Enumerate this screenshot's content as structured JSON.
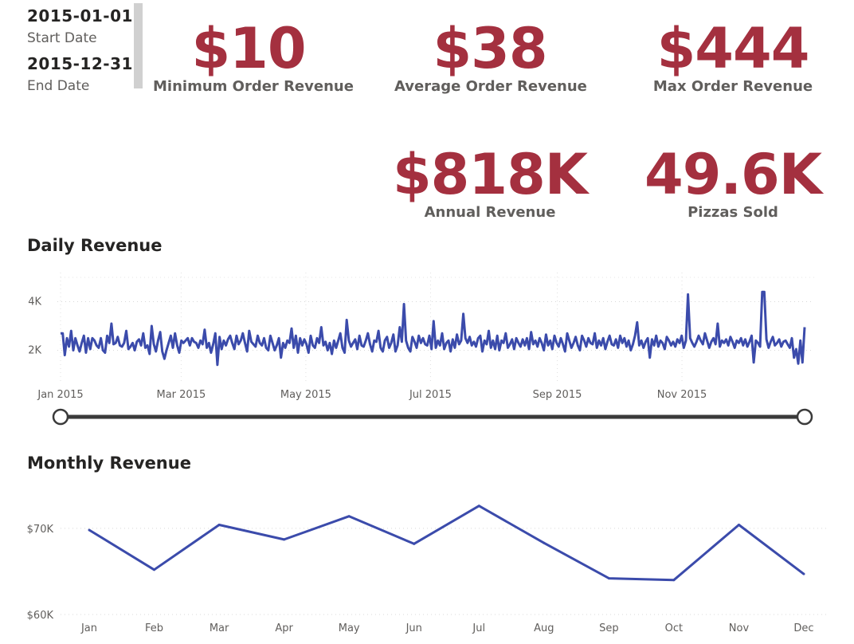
{
  "filters": {
    "start_date": "2015-01-01",
    "start_label": "Start Date",
    "end_date": "2015-12-31",
    "end_label": "End Date"
  },
  "kpis": {
    "min_order": {
      "value": "$10",
      "label": "Minimum Order Revenue"
    },
    "avg_order": {
      "value": "$38",
      "label": "Average Order Revenue"
    },
    "max_order": {
      "value": "$444",
      "label": "Max Order Revenue"
    },
    "annual": {
      "value": "$818K",
      "label": "Annual Revenue"
    },
    "pizzas": {
      "value": "49.6K",
      "label": "Pizzas Sold"
    }
  },
  "colors": {
    "kpi": "#a4303f",
    "line": "#3b4bab",
    "slider": "#3a3a3a"
  },
  "chart_data": [
    {
      "type": "line",
      "title": "Daily Revenue",
      "x_ticks": [
        "Jan 2015",
        "Mar 2015",
        "May 2015",
        "Jul 2015",
        "Sep 2015",
        "Nov 2015"
      ],
      "y_ticks": [
        "2K",
        "4K"
      ],
      "x_range": [
        "2015-01-01",
        "2015-12-31"
      ],
      "ylim": [
        1000,
        5000
      ],
      "grid": true,
      "range_slider": {
        "start": "2015-01-01",
        "end": "2015-12-31"
      },
      "series": [
        {
          "values": [
            2700,
            2700,
            1800,
            2500,
            2150,
            2800,
            2000,
            2500,
            2200,
            1950,
            2300,
            2600,
            1900,
            2500,
            2050,
            2500,
            2400,
            2200,
            2100,
            2500,
            2000,
            1900,
            2600,
            2300,
            3100,
            2250,
            2300,
            2550,
            2200,
            2150,
            2300,
            2800,
            2050,
            2150,
            2300,
            2000,
            2350,
            2450,
            2200,
            2700,
            2100,
            2200,
            1850,
            3000,
            2250,
            1950,
            2400,
            2750,
            1950,
            1650,
            2000,
            2300,
            2600,
            2100,
            2700,
            2200,
            1900,
            2400,
            2300,
            2400,
            2500,
            2200,
            2500,
            2350,
            2300,
            2100,
            2400,
            2250,
            2850,
            2100,
            2300,
            1900,
            2250,
            2700,
            1400,
            2550,
            2050,
            2400,
            2200,
            2450,
            2600,
            2300,
            2050,
            2600,
            2250,
            2400,
            2700,
            2300,
            1950,
            2800,
            2350,
            2250,
            2150,
            2600,
            2300,
            2200,
            2500,
            2100,
            2000,
            2600,
            2300,
            2000,
            2200,
            2500,
            1700,
            2300,
            2100,
            2400,
            2300,
            2900,
            2100,
            2600,
            1900,
            2500,
            2200,
            2450,
            2250,
            1900,
            2600,
            2200,
            2100,
            2500,
            2300,
            2950,
            2200,
            2350,
            2000,
            2300,
            1850,
            2400,
            2100,
            2400,
            2700,
            2100,
            1900,
            3250,
            2400,
            2150,
            2300,
            2450,
            2050,
            2600,
            2200,
            2150,
            2400,
            2700,
            2250,
            1950,
            2400,
            2350,
            2800,
            2100,
            1950,
            2400,
            2550,
            2100,
            2300,
            2650,
            1950,
            2200,
            2950,
            2350,
            2000,
            2400,
            2100,
            1950,
            2550,
            2350,
            2100,
            2600,
            2300,
            2500,
            2250,
            2200,
            2600,
            2050,
            2300,
            2100,
            2400,
            2200,
            2700,
            2050,
            2300,
            2400,
            1950,
            2450,
            2100,
            2650,
            2250,
            2400,
            2050,
            2500,
            2300,
            2550,
            2200,
            2350,
            2150,
            2500,
            2600,
            1950,
            2400,
            2250,
            2800,
            2100,
            2400,
            2050,
            2600,
            2000,
            2400,
            2300,
            2700,
            2100,
            2250,
            2450,
            2050,
            2500,
            2300,
            2150,
            2450,
            2200,
            2500,
            2050,
            2750,
            2250,
            2400,
            2150,
            2500,
            2300,
            2000,
            2650,
            2200,
            2400,
            2050,
            2600,
            2300,
            2150,
            2500,
            2250,
            1950,
            2700,
            2400,
            2100,
            2300,
            2550,
            2200,
            2000,
            2600,
            2400,
            2150,
            2500,
            2300,
            2250,
            2700,
            2100,
            2400,
            2200,
            2500,
            2050,
            2350,
            2600,
            2250,
            2200,
            2450,
            2100,
            2600,
            2300,
            2500,
            2150,
            2400,
            2000,
            2250,
            2600,
            2700,
            2200,
            2400,
            2100,
            2350,
            2500,
            2250,
            2450,
            2200,
            2600,
            2150,
            2400,
            2300,
            2050,
            2550,
            2400,
            2200,
            2350,
            2150,
            2450,
            2300,
            2600,
            2100,
            2400,
            2200,
            2500,
            2300,
            2150,
            2350,
            2600,
            2400,
            2250,
            2700,
            2400,
            2100,
            2350,
            2500,
            2250,
            2600,
            2150,
            2400,
            2300,
            2450,
            2200,
            2550,
            2350,
            2100,
            2400,
            2300,
            2500,
            2200,
            2450,
            2150,
            2350,
            2600,
            2200,
            2400,
            2300,
            2150,
            2500,
            2250,
            2450,
            2100,
            2350,
            2550,
            2200,
            2300,
            2450,
            2150,
            2350,
            2400,
            2250,
            2100,
            2500,
            1700,
            2050,
            1450,
            2400,
            1500,
            2950
          ],
          "spikes": [
            {
              "day": 162,
              "value": 3900
            },
            {
              "day": 176,
              "value": 3200
            },
            {
              "day": 190,
              "value": 3500
            },
            {
              "day": 296,
              "value": 4300
            },
            {
              "day": 331,
              "value": 4400
            },
            {
              "day": 332,
              "value": 4400
            },
            {
              "day": 327,
              "value": 1500
            },
            {
              "day": 272,
              "value": 3150
            },
            {
              "day": 310,
              "value": 3100
            },
            {
              "day": 278,
              "value": 1700
            }
          ]
        }
      ]
    },
    {
      "type": "line",
      "title": "Monthly Revenue",
      "categories": [
        "Jan",
        "Feb",
        "Mar",
        "Apr",
        "May",
        "Jun",
        "Jul",
        "Aug",
        "Sep",
        "Oct",
        "Nov",
        "Dec"
      ],
      "y_ticks": [
        "$60K",
        "$70K"
      ],
      "ylim": [
        60000,
        73500
      ],
      "grid": true,
      "series": [
        {
          "values": [
            69800,
            65200,
            70400,
            68700,
            71400,
            68200,
            72600,
            68300,
            64200,
            64000,
            70400,
            64700
          ]
        }
      ]
    }
  ]
}
